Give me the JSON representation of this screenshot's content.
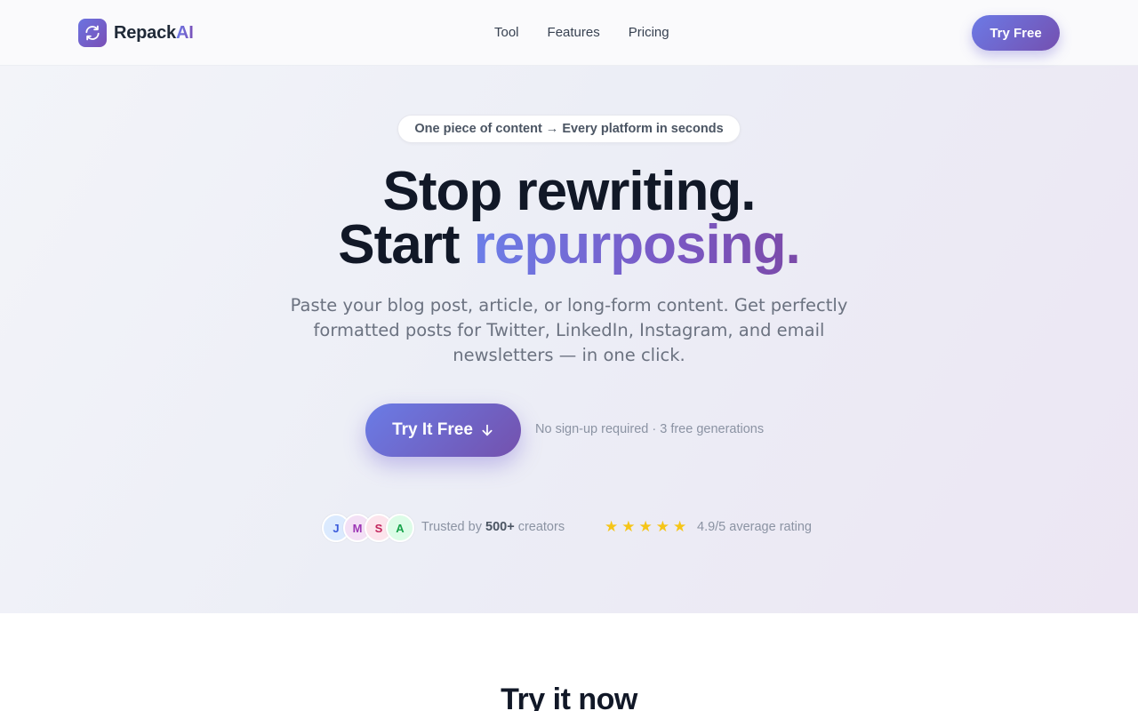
{
  "brand": {
    "name_prefix": "Repack",
    "name_suffix": "AI"
  },
  "nav": {
    "links": [
      "Tool",
      "Features",
      "Pricing"
    ],
    "cta_label": "Try Free"
  },
  "hero": {
    "pill": "One piece of content → Every platform in seconds",
    "headline_line1": "Stop rewriting.",
    "headline_line2_plain": "Start ",
    "headline_line2_accent": "repurposing.",
    "subtitle": "Paste your blog post, article, or long-form content. Get perfectly formatted posts for Twitter, LinkedIn, Instagram, and email newsletters — in one click.",
    "cta_label": "Try It Free",
    "cta_icon": "arrow-down-icon",
    "cta_note": "No sign-up required · 3 free generations"
  },
  "social_proof": {
    "avatars": [
      {
        "initial": "J",
        "bg": "#dbeafe",
        "fg": "#3b5bdb"
      },
      {
        "initial": "M",
        "bg": "#f3e0f5",
        "fg": "#9c36b5"
      },
      {
        "initial": "S",
        "bg": "#fce4ec",
        "fg": "#c2255c"
      },
      {
        "initial": "A",
        "bg": "#dcfce7",
        "fg": "#16a34a"
      }
    ],
    "trusted_prefix": "Trusted by ",
    "trusted_count": "500+",
    "trusted_suffix": " creators",
    "star_count": 5,
    "rating_text": "4.9/5 average rating"
  },
  "next_section": {
    "title": "Try it now"
  },
  "colors": {
    "brand_start": "#6b7ae8",
    "brand_end": "#7450b0",
    "star": "#f5c518"
  }
}
